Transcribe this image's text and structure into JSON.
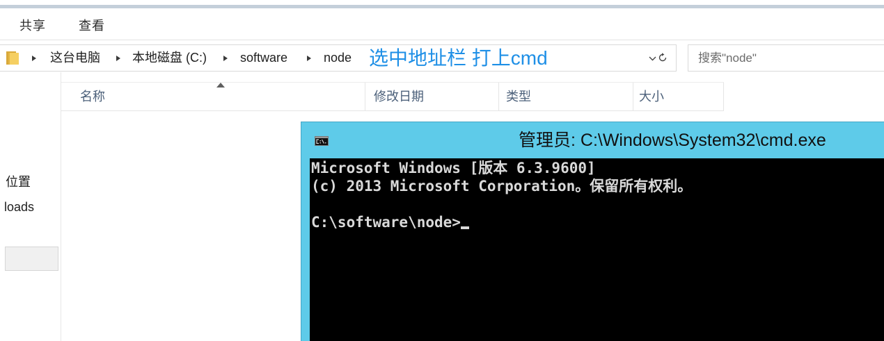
{
  "ribbon": {
    "tabs": [
      "共享",
      "查看"
    ]
  },
  "address_bar": {
    "crumbs": [
      "这台电脑",
      "本地磁盘 (C:)",
      "software",
      "node"
    ],
    "annotation": "选中地址栏 打上cmd",
    "annotation_color": "#1e8fe6",
    "icons": [
      "folder-icon",
      "breadcrumb-arrow-icon",
      "chevron-down-icon",
      "refresh-icon"
    ]
  },
  "search": {
    "placeholder": "搜索\"node\""
  },
  "file_list": {
    "columns": [
      "名称",
      "修改日期",
      "类型",
      "大小"
    ],
    "header_text_color": "#4c607a",
    "sort_icon": "sort-ascending-icon"
  },
  "nav_pane": {
    "items": [
      "位置",
      "loads"
    ]
  },
  "cmd_window": {
    "title": "管理员: C:\\Windows\\System32\\cmd.exe",
    "icon": "cmd-icon",
    "frame_color": "#5ecbe9",
    "console_text_color": "#d9d9d9",
    "lines": [
      "Microsoft Windows [版本 6.3.9600]",
      "(c) 2013 Microsoft Corporation。保留所有权利。",
      "",
      "C:\\software\\node>"
    ]
  }
}
